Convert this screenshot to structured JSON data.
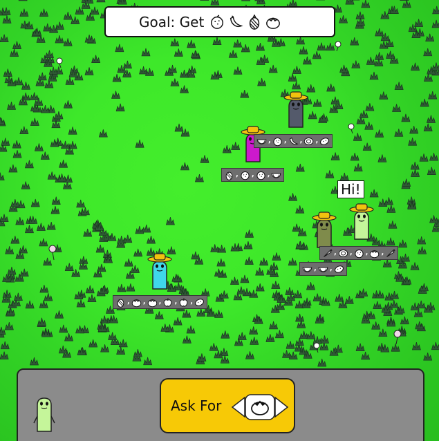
{
  "goal": {
    "label": "Goal: Get",
    "items": [
      "orange-icon",
      "banana-icon",
      "pineapple-icon",
      "tomato-icon"
    ]
  },
  "speech_bubble": {
    "text": "Hi!"
  },
  "characters": [
    {
      "id": "grey",
      "hat": true,
      "color": "#545a6b"
    },
    {
      "id": "magenta",
      "hat": true,
      "color": "#cc19cc"
    },
    {
      "id": "olive",
      "hat": true,
      "color": "#7f8b4b"
    },
    {
      "id": "pale-green",
      "hat": true,
      "color": "#c5f59a"
    },
    {
      "id": "cyan",
      "hat": true,
      "color": "#3fd7ea"
    }
  ],
  "trays": [
    {
      "owner": "grey",
      "items": [
        "watermelon-icon",
        "orange-icon",
        "banana-icon",
        "coconut-icon",
        "potato-icon"
      ]
    },
    {
      "owner": "magenta",
      "items": [
        "pineapple-icon",
        "orange-icon",
        "orange-icon",
        "watermelon-icon"
      ]
    },
    {
      "owner": "pale-green",
      "items": [
        "carrot-icon",
        "coconut-icon",
        "orange-icon",
        "tomato-icon",
        "carrot-icon"
      ]
    },
    {
      "owner": "olive",
      "items": [
        "watermelon-icon",
        "watermelon-icon",
        "potato-icon"
      ]
    },
    {
      "owner": "cyan",
      "items": [
        "pineapple-icon",
        "tomato-icon",
        "tomato-icon",
        "apple-icon",
        "apple-icon",
        "potato-icon"
      ]
    }
  ],
  "panel": {
    "player_avatar": "pale-green-character",
    "ask_label": "Ask For",
    "selected_item": "tomato-icon"
  },
  "colors": {
    "grass": "#3ee82a",
    "panel": "#8b8b8b",
    "ask_button": "#f7c906"
  }
}
